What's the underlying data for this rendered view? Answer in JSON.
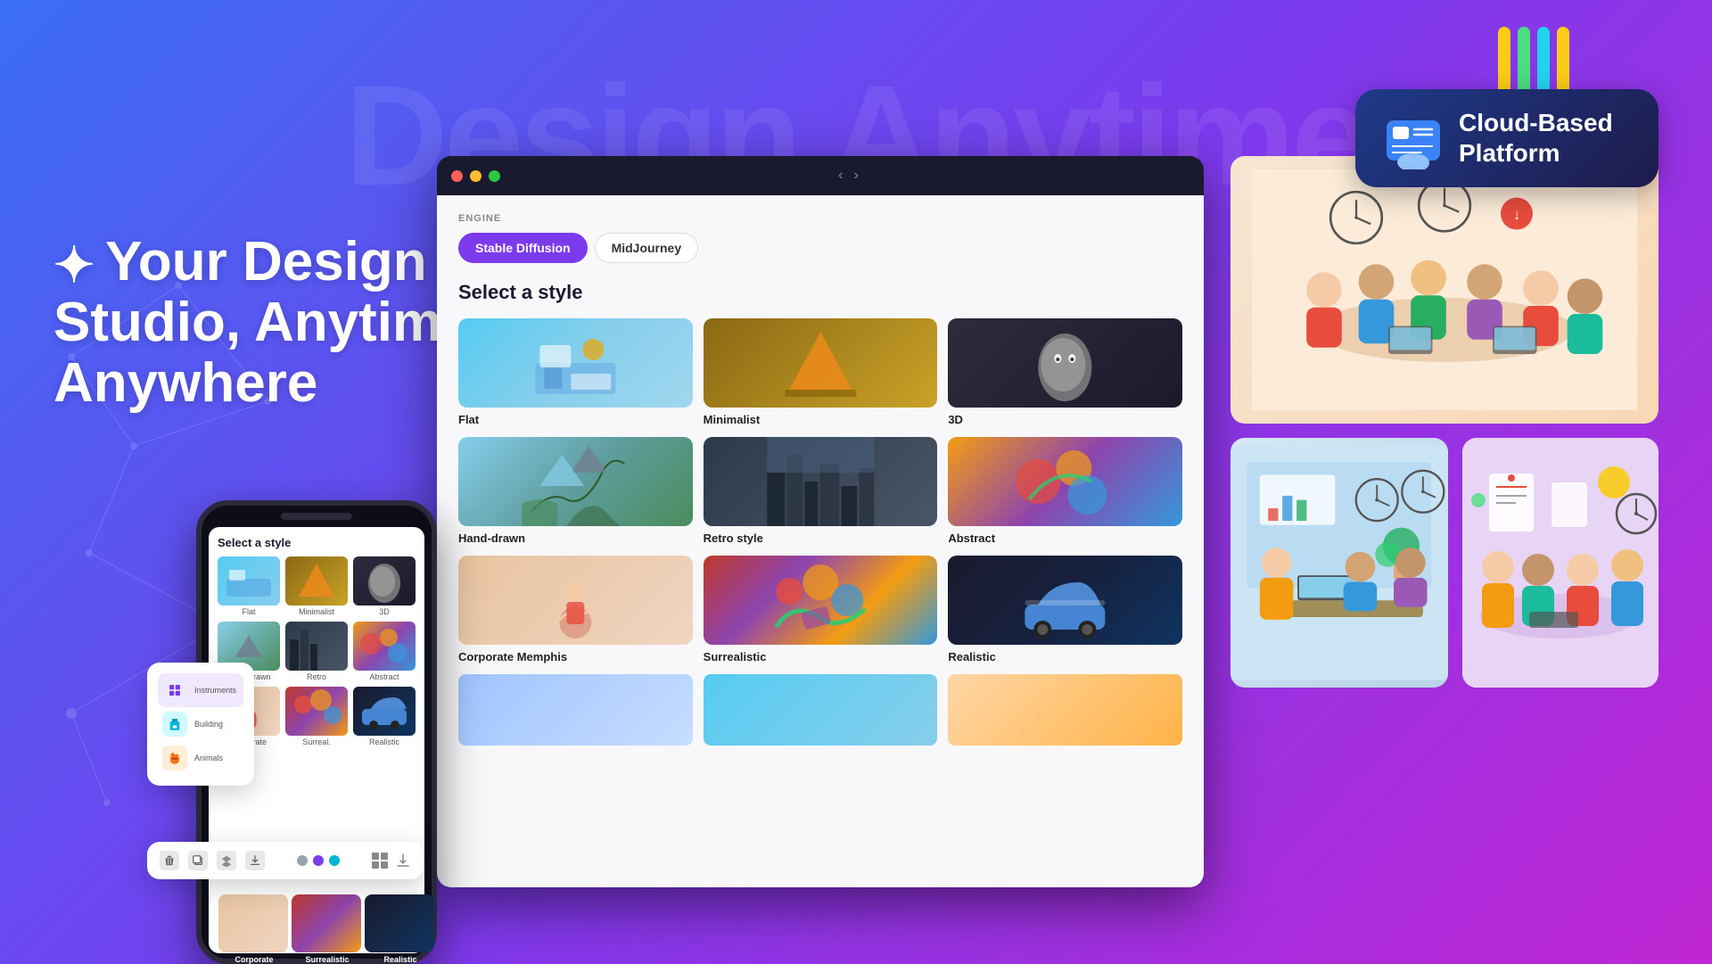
{
  "background": {
    "watermark_text": "Design Anytime"
  },
  "cloud_badge": {
    "title": "Cloud-Based Platform",
    "straws": [
      {
        "color": "#facc15"
      },
      {
        "color": "#4ade80"
      },
      {
        "color": "#22d3ee"
      },
      {
        "color": "#facc15"
      }
    ]
  },
  "hero": {
    "star_icon": "✦",
    "headline_line1": "Your Design",
    "headline_line2": "Studio, Anytime,",
    "headline_line3": "Anywhere"
  },
  "app_window": {
    "engine_label": "ENGINE",
    "tabs": [
      {
        "label": "Stable Diffusion",
        "active": true
      },
      {
        "label": "MidJourney",
        "active": false
      }
    ],
    "section_title": "Select a style",
    "styles": [
      {
        "label": "Flat",
        "thumb_class": "thumb-flat"
      },
      {
        "label": "Minimalist",
        "thumb_class": "thumb-minimalist"
      },
      {
        "label": "3D",
        "thumb_class": "thumb-3d"
      },
      {
        "label": "Hand-drawn",
        "thumb_class": "thumb-handdrawn"
      },
      {
        "label": "Retro style",
        "thumb_class": "thumb-retro"
      },
      {
        "label": "Abstract",
        "thumb_class": "thumb-abstract"
      },
      {
        "label": "Corporate Memphis",
        "thumb_class": "thumb-corporate"
      },
      {
        "label": "Surrealistic",
        "thumb_class": "thumb-surrealistic"
      },
      {
        "label": "Realistic",
        "thumb_class": "thumb-realistic"
      }
    ]
  },
  "phone": {
    "select_title": "Select a style",
    "styles": [
      {
        "label": "Flat",
        "bg": "#87CEEB"
      },
      {
        "label": "Minimalist",
        "bg": "#d4845a"
      },
      {
        "label": "3D",
        "bg": "#444"
      },
      {
        "label": "Hand-drawn",
        "bg": "#4a7c59"
      },
      {
        "label": "Retro",
        "bg": "#708090"
      },
      {
        "label": "Abstract",
        "bg": "#f39c12"
      },
      {
        "label": "Corporate",
        "bg": "#e8a87c"
      },
      {
        "label": "Surreal.",
        "bg": "#c0392b"
      },
      {
        "label": "Realistic",
        "bg": "#1a1a2e"
      }
    ]
  },
  "sidebar_card": {
    "items": [
      {
        "label": "Instruments",
        "color": "#7c3aed"
      },
      {
        "label": "Building",
        "color": "#06b6d4"
      },
      {
        "label": "Animals",
        "color": "#f97316"
      }
    ]
  },
  "toolbar": {
    "dots": [
      {
        "color": "#9ca3af"
      },
      {
        "color": "#7c3aed"
      },
      {
        "color": "#06b6d4"
      }
    ]
  },
  "bottom_styles": [
    {
      "label": "Corporate",
      "bg": "#e8a87c"
    },
    {
      "label": "Surrealistic",
      "bg": "#c0392b"
    },
    {
      "label": "Realistic",
      "bg": "#1a1a2e"
    }
  ],
  "window_controls": {
    "close": "#ff5f57",
    "minimize": "#febc2e",
    "maximize": "#28c840"
  }
}
